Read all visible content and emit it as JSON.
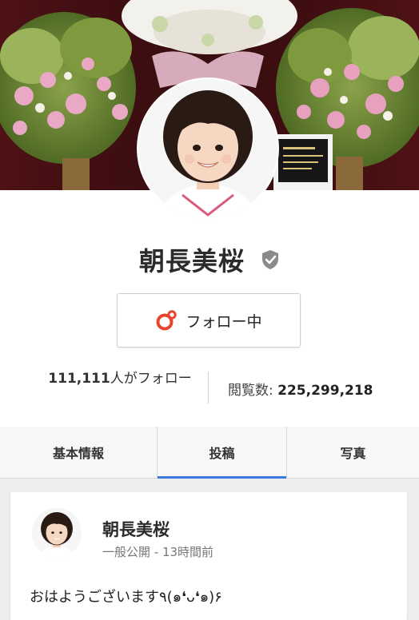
{
  "profile": {
    "name": "朝長美桜",
    "follow_label": "フォロー中",
    "followers_count": "111,111",
    "followers_suffix": "人がフォロー",
    "views_label": "閲覧数: ",
    "views_count": "225,299,218"
  },
  "tabs": [
    {
      "label": "基本情報",
      "active": false
    },
    {
      "label": "投稿",
      "active": true
    },
    {
      "label": "写真",
      "active": false
    }
  ],
  "post": {
    "author": "朝長美桜",
    "visibility": "一般公開",
    "separator": " - ",
    "time": "13時間前",
    "text": "おはようございます٩(๑❛ᴗ❛๑)۶"
  },
  "colors": {
    "accent_blue": "#3d7ae0",
    "follow_icon": "#e8452c",
    "verified_badge": "#8a8a8a"
  },
  "icons": {
    "verified": "verified-shield-icon",
    "follow": "google-plus-follow-icon"
  }
}
